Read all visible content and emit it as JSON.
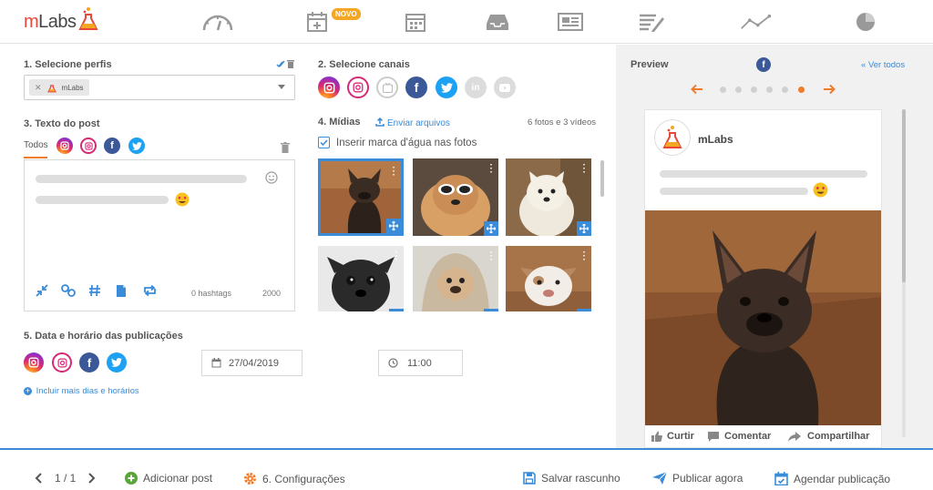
{
  "app": {
    "logo_text": "mLabs"
  },
  "nav": {
    "items": [
      "dashboard-icon",
      "calendar-add-icon",
      "calendar-icon",
      "inbox-icon",
      "newspaper-icon",
      "report-icon",
      "analytics-icon",
      "pie-chart-icon"
    ],
    "new_badge": "NOVO"
  },
  "profiles": {
    "title": "1. Selecione perfis",
    "chip_label": "mLabs"
  },
  "channels": {
    "title": "2. Selecione canais"
  },
  "post_text": {
    "title": "3. Texto do post",
    "tab_all": "Todos",
    "hashtags": "0 hashtags",
    "char_count": "2000"
  },
  "media": {
    "title": "4. Mídias",
    "upload_link": "Enviar arquivos",
    "count": "6 fotos e 3 vídeos",
    "watermark_label": "Inserir marca d'água nas fotos"
  },
  "schedule": {
    "title": "5. Data e horário das publicações",
    "date": "27/04/2019",
    "time": "11:00",
    "add_link": "Incluir mais dias e horários"
  },
  "preview": {
    "title": "Preview",
    "see_all": "Ver todos",
    "profile_name": "mLabs",
    "like": "Curtir",
    "comment": "Comentar",
    "share": "Compartilhar"
  },
  "footer": {
    "pagination": "1 / 1",
    "add_post": "Adicionar post",
    "settings": "6. Configurações",
    "save_draft": "Salvar rascunho",
    "publish_now": "Publicar agora",
    "schedule_post": "Agendar publicação"
  },
  "colors": {
    "accent_blue": "#3a8bd8",
    "accent_orange": "#f07c2b",
    "facebook": "#3b5998",
    "twitter": "#1da1f2"
  }
}
